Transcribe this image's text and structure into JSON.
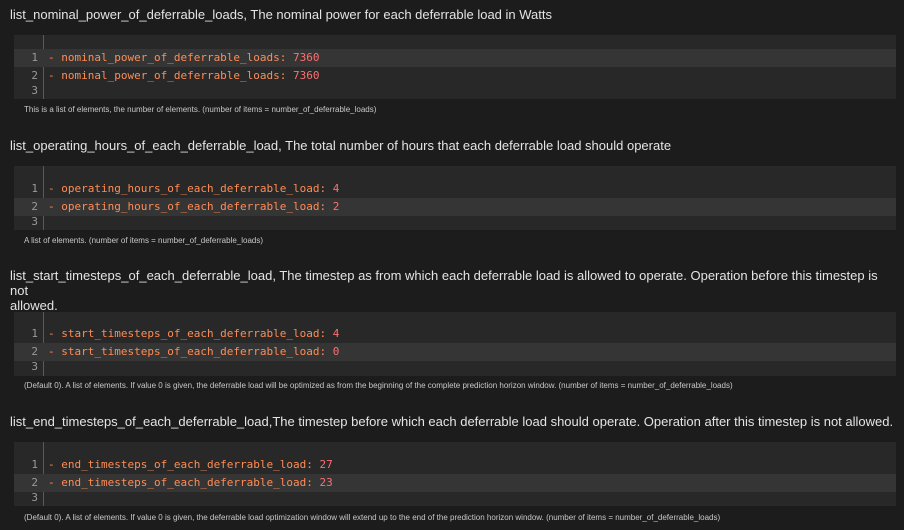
{
  "sections": [
    {
      "title": "list_nominal_power_of_deferrable_loads, The nominal power for each deferrable load in Watts",
      "lines": [
        {
          "num": "1",
          "key": "- nominal_power_of_deferrable_loads",
          "sep": ": ",
          "value": "7360"
        },
        {
          "num": "2",
          "key": "- nominal_power_of_deferrable_loads",
          "sep": ": ",
          "value": "7360"
        },
        {
          "num": "3"
        }
      ],
      "helper": "This is a list of elements, the number of elements. (number of items = number_of_deferrable_loads)"
    },
    {
      "title": "list_operating_hours_of_each_deferrable_load, The total number of hours that each deferrable load should operate",
      "lines": [
        {
          "num": "1",
          "key": "- operating_hours_of_each_deferrable_load",
          "sep": ": ",
          "value": "4"
        },
        {
          "num": "2",
          "key": "- operating_hours_of_each_deferrable_load",
          "sep": ": ",
          "value": "2"
        },
        {
          "num": "3"
        }
      ],
      "helper": "A list of elements. (number of items = number_of_deferrable_loads)"
    },
    {
      "title_line1": "list_start_timesteps_of_each_deferrable_load, The timestep as from which each deferrable load is allowed to operate. Operation before this timestep is not",
      "title_line2": "allowed.",
      "lines": [
        {
          "num": "1",
          "key": "- start_timesteps_of_each_deferrable_load",
          "sep": ": ",
          "value": "4"
        },
        {
          "num": "2",
          "key": "- start_timesteps_of_each_deferrable_load",
          "sep": ": ",
          "value": "0"
        },
        {
          "num": "3"
        }
      ],
      "helper": "(Default 0). A list of elements. If value 0 is given, the deferrable load will be optimized as from the beginning of the complete prediction horizon window. (number of items = number_of_deferrable_loads)"
    },
    {
      "title": "list_end_timesteps_of_each_deferrable_load,The timestep before which each deferrable load should operate. Operation after this timestep is not allowed.",
      "lines": [
        {
          "num": "1",
          "key": "- end_timesteps_of_each_deferrable_load",
          "sep": ": ",
          "value": "27"
        },
        {
          "num": "2",
          "key": "- end_timesteps_of_each_deferrable_load",
          "sep": ": ",
          "value": "23"
        },
        {
          "num": "3"
        }
      ],
      "helper": "(Default 0). A list of elements. If value 0 is given, the deferrable load optimization window will extend up to the end of the prediction horizon window. (number of items = number_of_deferrable_loads)"
    }
  ],
  "colors": {
    "background": "#1c1c1c",
    "editor_background": "#282828",
    "active_line": "#353535",
    "key": "#ff8c55",
    "value": "#ff6f6f"
  }
}
